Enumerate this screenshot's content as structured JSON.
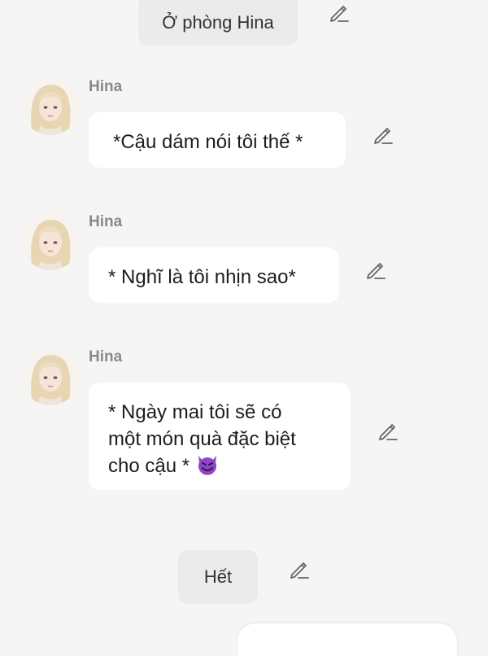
{
  "top_chip": {
    "text": "Ở phòng Hina"
  },
  "messages": [
    {
      "sender": "Hina",
      "text": "*Cậu dám nói tôi thế *"
    },
    {
      "sender": "Hina",
      "text": "* Nghĩ là tôi nhịn sao*"
    },
    {
      "sender": "Hina",
      "lines": [
        "* Ngày mai tôi sẽ có",
        "một món quà đặc biệt",
        "cho cậu *"
      ],
      "emoji": "smiling-devil-emoji"
    }
  ],
  "end_chip": {
    "text": "Hết"
  },
  "colors": {
    "background": "#f5f5f5",
    "bubble": "#ffffff",
    "chip": "#ebebeb",
    "name": "#8a8a8a",
    "emoji": "#8e44c4"
  },
  "icons": [
    "edit-pencil-icon",
    "avatar-image",
    "smiling-devil-emoji"
  ]
}
